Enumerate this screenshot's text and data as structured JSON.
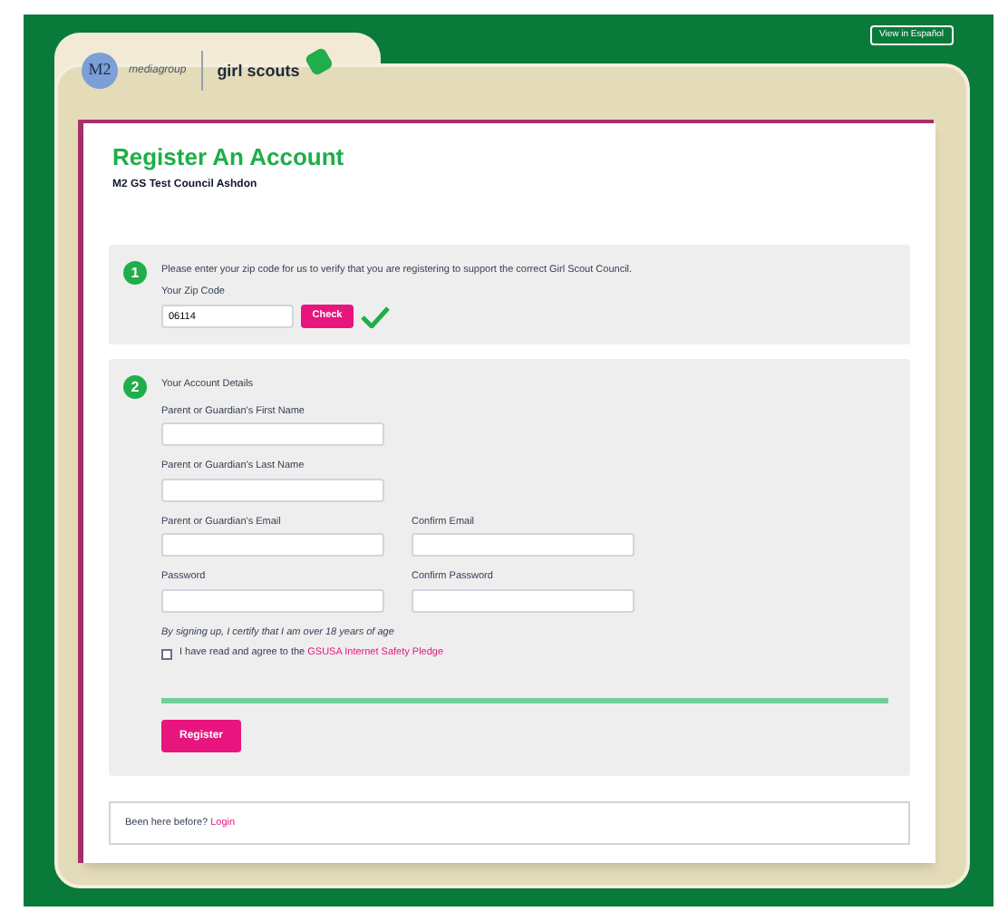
{
  "language_button": "View in Español",
  "logo": {
    "partner_mark": "M2",
    "partner_name": "mediagroup",
    "brand": "girl scouts"
  },
  "title": "Register An Account",
  "council": "M2 GS Test Council Ashdon",
  "step_1": {
    "number": "1",
    "instruction": "Please enter your zip code for us to verify that you are registering to support the correct Girl Scout Council.",
    "zip_label": "Your Zip Code",
    "zip_value": "06114",
    "check_button": "Check",
    "verified": true
  },
  "step_2": {
    "number": "2",
    "heading": "Your Account Details",
    "fields": [
      {
        "label": "Parent or Guardian's First Name"
      },
      {
        "label": "Parent or Guardian's Last Name"
      },
      {
        "label": "Parent or Guardian's Email"
      },
      {
        "label": "Confirm Email"
      },
      {
        "label": "Password"
      },
      {
        "label": "Confirm Password"
      }
    ],
    "age_note": "By signing up, I certify that I am over 18 years of age",
    "pledge": {
      "text": "I have read and agree to the",
      "link": "GSUSA Internet Safety Pledge",
      "checked": false
    },
    "register_button": "Register"
  },
  "footer": {
    "text": "Been here before?",
    "link": "Login"
  }
}
